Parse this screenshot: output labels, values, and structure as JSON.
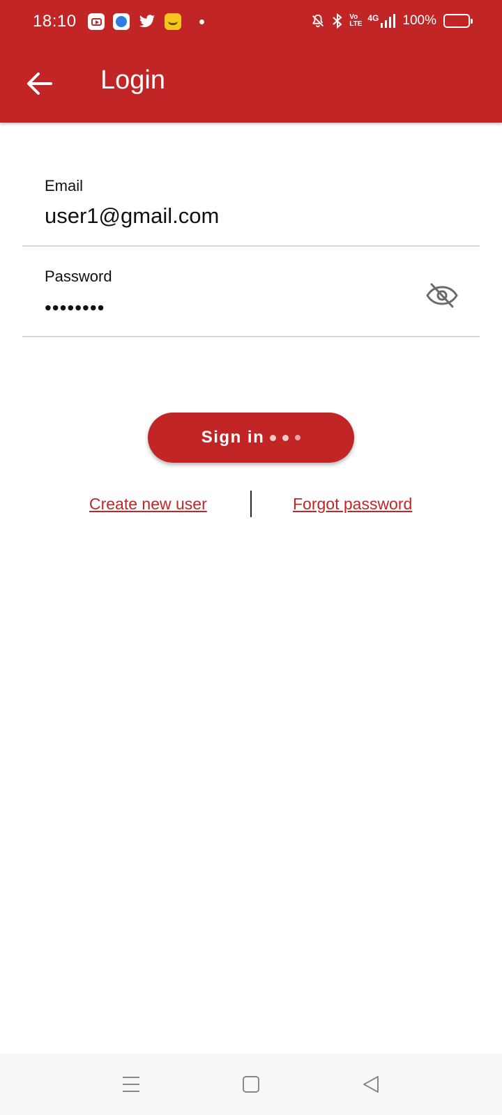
{
  "status_bar": {
    "time": "18:10",
    "notification_icons": [
      "youtube-icon",
      "messenger-icon",
      "twitter-icon",
      "emoji-app-icon",
      "more-dot-icon"
    ],
    "system_icons": [
      "bell-off-icon",
      "bluetooth-icon",
      "volte-icon",
      "4g-signal-icon"
    ],
    "lte_top": "Vo",
    "lte_bottom": "LTE",
    "network": "4G",
    "battery": "100%"
  },
  "app_bar": {
    "title": "Login",
    "back_icon": "arrow-left-icon"
  },
  "form": {
    "email": {
      "label": "Email",
      "value": "user1@gmail.com"
    },
    "password": {
      "label": "Password",
      "masked_value": "••••••••",
      "toggle_icon": "eye-off-icon"
    }
  },
  "sign_in": {
    "label": "Sign in",
    "loading": true
  },
  "links": {
    "create_user": "Create new user",
    "forgot_password": "Forgot password"
  },
  "nav_bar": {
    "icons": [
      "menu-icon",
      "home-square-icon",
      "back-triangle-icon"
    ]
  },
  "colors": {
    "primary": "#c12526",
    "link": "#c12526",
    "divider": "#d7d7d7",
    "nav_bg": "#f7f7f7"
  }
}
